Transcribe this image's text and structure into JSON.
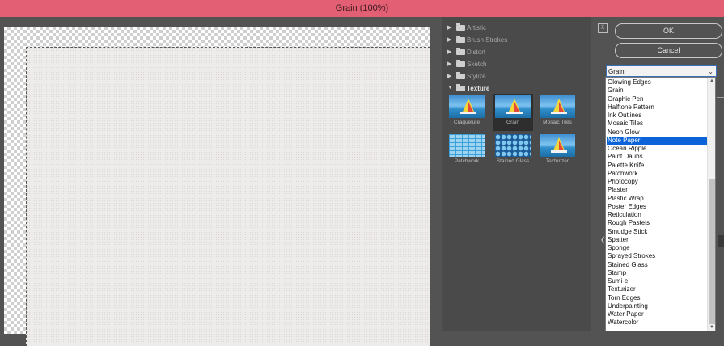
{
  "window": {
    "title": "Grain (100%)"
  },
  "gallery": {
    "categories": [
      {
        "label": "Artistic",
        "open": false
      },
      {
        "label": "Brush Strokes",
        "open": false
      },
      {
        "label": "Distort",
        "open": false
      },
      {
        "label": "Sketch",
        "open": false
      },
      {
        "label": "Stylize",
        "open": false
      },
      {
        "label": "Texture",
        "open": true
      }
    ],
    "thumbnails": [
      {
        "label": "Craquelure",
        "selected": false
      },
      {
        "label": "Grain",
        "selected": true
      },
      {
        "label": "Mosaic Tiles",
        "selected": false
      },
      {
        "label": "Patchwork",
        "selected": false
      },
      {
        "label": "Stained Glass",
        "selected": false
      },
      {
        "label": "Texturizer",
        "selected": false
      }
    ],
    "toggle_icon": "collapse-icon"
  },
  "buttons": {
    "ok": "OK",
    "cancel": "Cancel"
  },
  "filter_select": {
    "value": "Grain",
    "options": [
      "Glowing Edges",
      "Grain",
      "Graphic Pen",
      "Halftone Pattern",
      "Ink Outlines",
      "Mosaic Tiles",
      "Neon Glow",
      "Note Paper",
      "Ocean Ripple",
      "Paint Daubs",
      "Palette Knife",
      "Patchwork",
      "Photocopy",
      "Plaster",
      "Plastic Wrap",
      "Poster Edges",
      "Reticulation",
      "Rough Pastels",
      "Smudge Stick",
      "Spatter",
      "Sponge",
      "Sprayed Strokes",
      "Stained Glass",
      "Stamp",
      "Sumi-e",
      "Texturizer",
      "Torn Edges",
      "Underpainting",
      "Water Paper",
      "Watercolor"
    ],
    "highlighted": "Note Paper"
  },
  "colors": {
    "titlebar": "#e35f73",
    "panel": "#535353",
    "highlight": "#0a64d8"
  }
}
